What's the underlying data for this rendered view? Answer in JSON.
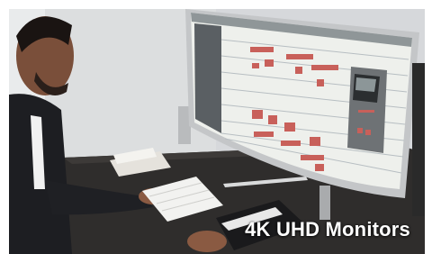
{
  "caption": {
    "text": "4K UHD Monitors"
  },
  "scene": {
    "subject": "person-at-desk",
    "objects": [
      "curved-monitor",
      "keyboard",
      "notebook",
      "phone",
      "music-keyboard"
    ]
  },
  "colors": {
    "wall": "#d9dbde",
    "desk": "#2f2d2c",
    "monitor_bezel": "#c4c6c8",
    "screen_bg": "#eef0ec",
    "track_red": "#c8605a",
    "caption_text": "#ffffff"
  }
}
